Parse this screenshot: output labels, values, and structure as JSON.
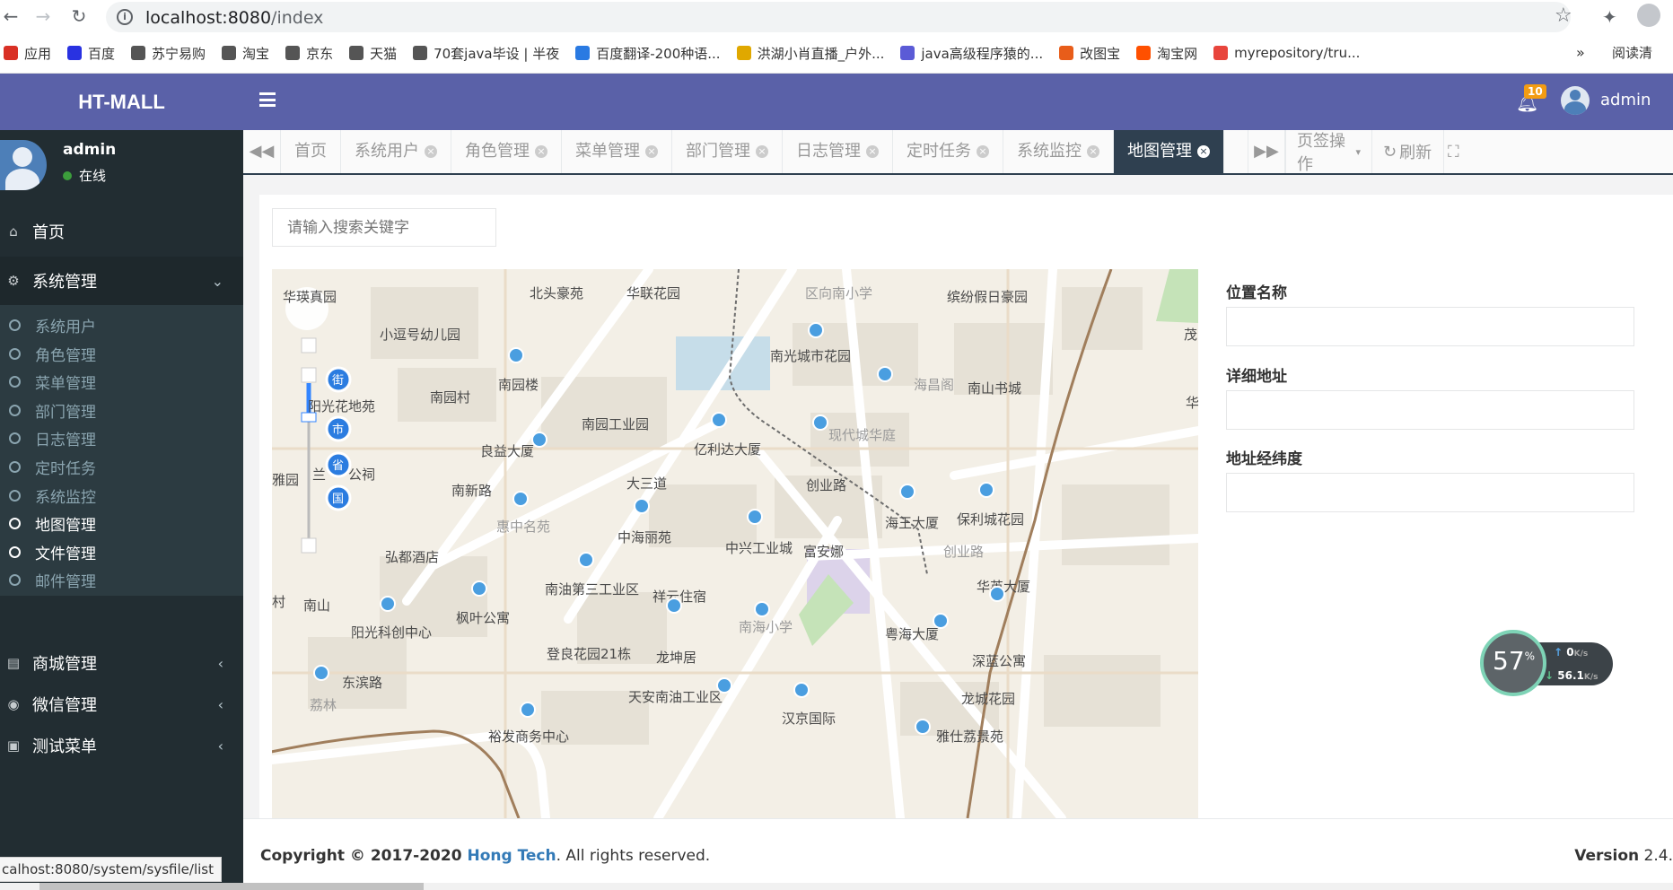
{
  "browser": {
    "url_host": "localhost:8080",
    "url_path": "/index",
    "bookmarks": [
      {
        "label": "应用",
        "color": "#d93025"
      },
      {
        "label": "百度",
        "color": "#2932e1"
      },
      {
        "label": "苏宁易购",
        "color": "#555555"
      },
      {
        "label": "淘宝",
        "color": "#555555"
      },
      {
        "label": "京东",
        "color": "#555555"
      },
      {
        "label": "天猫",
        "color": "#555555"
      },
      {
        "label": "70套java毕设 | 半夜",
        "color": "#555555"
      },
      {
        "label": "百度翻译-200种语...",
        "color": "#2a7ae2"
      },
      {
        "label": "洪湖小肖直播_户外...",
        "color": "#e0a800"
      },
      {
        "label": "java高级程序猿的...",
        "color": "#5b5bd6"
      },
      {
        "label": "改图宝",
        "color": "#e85d1a"
      },
      {
        "label": "淘宝网",
        "color": "#ff5000"
      },
      {
        "label": "myrepository/tru...",
        "color": "#e8453c"
      }
    ],
    "more": "»",
    "reading_list": "阅读清"
  },
  "brand": "HT-MALL",
  "user": {
    "name": "admin",
    "status": "在线"
  },
  "topbar": {
    "notification_count": "10",
    "username": "admin"
  },
  "sidebar": {
    "home": "首页",
    "system": "系统管理",
    "sub_items": [
      "系统用户",
      "角色管理",
      "菜单管理",
      "部门管理",
      "日志管理",
      "定时任务",
      "系统监控",
      "地图管理",
      "文件管理",
      "邮件管理"
    ],
    "active_sub": "地图管理",
    "mall": "商城管理",
    "wechat": "微信管理",
    "test": "测试菜单"
  },
  "tabs": [
    {
      "label": "首页",
      "closable": false,
      "active": false
    },
    {
      "label": "系统用户",
      "closable": true,
      "active": false
    },
    {
      "label": "角色管理",
      "closable": true,
      "active": false
    },
    {
      "label": "菜单管理",
      "closable": true,
      "active": false
    },
    {
      "label": "部门管理",
      "closable": true,
      "active": false
    },
    {
      "label": "日志管理",
      "closable": true,
      "active": false
    },
    {
      "label": "定时任务",
      "closable": true,
      "active": false
    },
    {
      "label": "系统监控",
      "closable": true,
      "active": false
    },
    {
      "label": "地图管理",
      "closable": true,
      "active": true
    }
  ],
  "tab_actions": {
    "page_ops": "页签操作",
    "refresh": "刷新"
  },
  "search": {
    "placeholder": "请输入搜索关键字"
  },
  "form": {
    "location_name_label": "位置名称",
    "address_label": "详细地址",
    "coords_label": "地址经纬度",
    "location_name_value": "",
    "address_value": "",
    "coords_value": ""
  },
  "map": {
    "labels": [
      "华联花园",
      "华瑛真园",
      "北头豪苑",
      "区向南小学",
      "缤纷假日豪园",
      "茂",
      "小逗号幼儿园",
      "南光城市花园",
      "南园楼",
      "南园村",
      "海昌阁",
      "南山书城",
      "华",
      "南园工业园",
      "阳光花地苑",
      "良益大厦",
      "亿利达大厦",
      "现代城华庭",
      "大三道",
      "南新路",
      "创业路",
      "兰",
      "公祠",
      "雅园",
      "惠中名苑",
      "中海丽苑",
      "中兴工业城",
      "富安娜",
      "海王大厦",
      "保利城花园",
      "弘都酒店",
      "创业路",
      "南油第三工业区",
      "祥云住宿",
      "华英大厦",
      "村",
      "南山",
      "枫叶公寓",
      "南海小学",
      "阳光科创中心",
      "粤海大厦",
      "深蓝公寓",
      "登良花园21栋",
      "龙坤居",
      "东滨路",
      "荔林",
      "天安南油工业区",
      "汉京国际",
      "龙城花园",
      "裕发商务中心",
      "雅仕荔景苑"
    ],
    "poi_tags": [
      "街",
      "市",
      "省",
      "国"
    ]
  },
  "speed_widget": {
    "percent": "57",
    "up": "0",
    "up_unit": "K/s",
    "down": "56.1",
    "down_unit": "K/s"
  },
  "footer": {
    "copyright": "Copyright © 2017-2020 ",
    "company": "Hong Tech",
    "rights": ". All rights reserved.",
    "version_label": "Version",
    "version_value": "2.4."
  },
  "status_bar": {
    "url": "calhost:8080/system/sysfile/list"
  }
}
